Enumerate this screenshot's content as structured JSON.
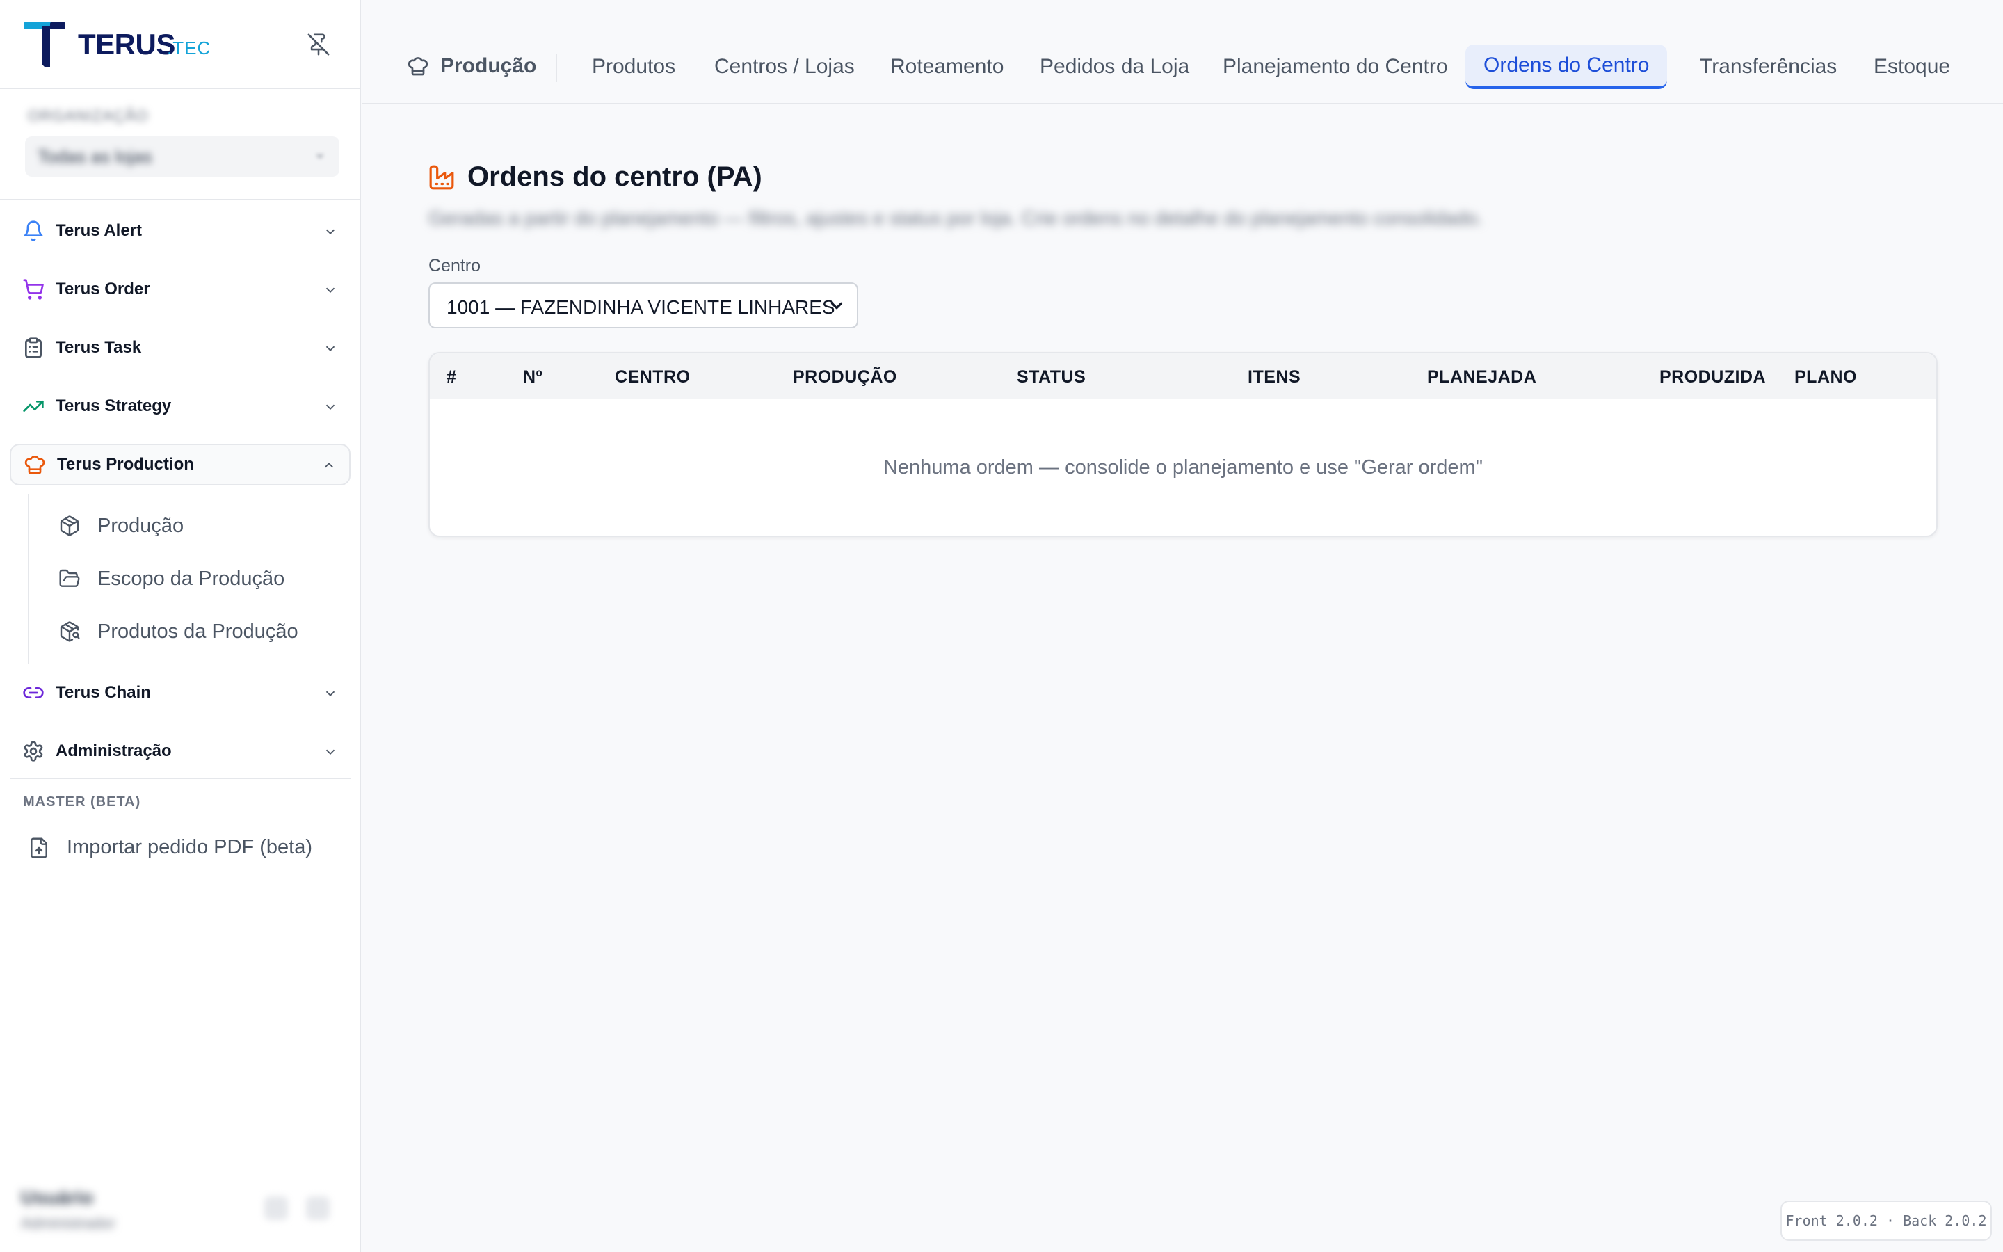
{
  "brand": {
    "name": "TERUS",
    "suffix": ".TEC",
    "primary_color": "#0d1b5e",
    "accent_color": "#14a3d8"
  },
  "sidebar": {
    "org": {
      "label": "ORGANIZAÇÃO",
      "value": "Todas as lojas"
    },
    "items": [
      {
        "label": "Terus Alert",
        "icon": "bell-icon",
        "color": "#3b82f6"
      },
      {
        "label": "Terus Order",
        "icon": "cart-icon",
        "color": "#9333ea"
      },
      {
        "label": "Terus Task",
        "icon": "clipboard-icon",
        "color": "#4b5563"
      },
      {
        "label": "Terus Strategy",
        "icon": "trending-up-icon",
        "color": "#059669"
      },
      {
        "label": "Terus Production",
        "icon": "chef-hat-icon",
        "color": "#ea580c"
      },
      {
        "label": "Terus Chain",
        "icon": "link-icon",
        "color": "#6d28d9"
      },
      {
        "label": "Administração",
        "icon": "gear-icon",
        "color": "#4b5563"
      }
    ],
    "production_sub": [
      {
        "label": "Produção",
        "icon": "box-icon"
      },
      {
        "label": "Escopo da Produção",
        "icon": "folder-open-icon"
      },
      {
        "label": "Produtos da Produção",
        "icon": "package-search-icon"
      }
    ],
    "section_label": "MASTER (BETA)",
    "import_label": "Importar pedido PDF (beta)",
    "user": {
      "name": "Usuário",
      "role": "Administrador"
    }
  },
  "topnav": {
    "crumb": "Produção",
    "tabs": [
      "Produtos",
      "Centros / Lojas",
      "Roteamento",
      "Pedidos da Loja",
      "Planejamento do Centro",
      "Ordens do Centro",
      "Transferências",
      "Estoque"
    ],
    "active_tab": "Ordens do Centro"
  },
  "page": {
    "title": "Ordens do centro (PA)",
    "description": "Geradas a partir do planejamento — filtros, ajustes e status por loja. Crie ordens no detalhe do planejamento consolidado.",
    "field_label": "Centro",
    "center_value": "1001 — FAZENDINHA VICENTE LINHARES",
    "table": {
      "columns": [
        "#",
        "Nº",
        "CENTRO",
        "PRODUÇÃO",
        "STATUS",
        "ITENS",
        "PLANEJADA",
        "PRODUZIDA",
        "PLANO"
      ],
      "empty_message": "Nenhuma ordem — consolide o planejamento e use \"Gerar ordem\""
    }
  },
  "version": "Front 2.0.2 · Back 2.0.2"
}
